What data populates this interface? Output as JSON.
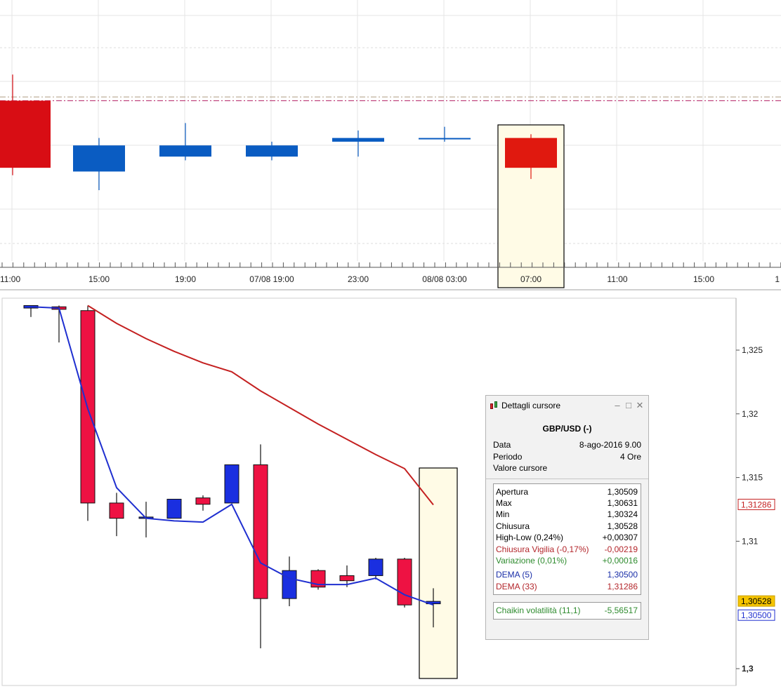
{
  "chart_data": [
    {
      "type": "candlestick",
      "x_labels": [
        "11:00",
        "15:00",
        "19:00",
        "07/08 19:00",
        "23:00",
        "08/08 03:00",
        "07:00",
        "11:00",
        "15:00",
        "1"
      ],
      "candles": [
        {
          "open": 1.3068,
          "high": 1.3075,
          "low": 1.3048,
          "close": 1.305
        },
        {
          "open": 1.3049,
          "high": 1.3058,
          "low": 1.3044,
          "close": 1.3056
        },
        {
          "open": 1.3053,
          "high": 1.3062,
          "low": 1.3052,
          "close": 1.3056
        },
        {
          "open": 1.3053,
          "high": 1.3057,
          "low": 1.3052,
          "close": 1.3056
        },
        {
          "open": 1.3057,
          "high": 1.306,
          "low": 1.3053,
          "close": 1.3058
        },
        {
          "open": 1.3058,
          "high": 1.3061,
          "low": 1.3057,
          "close": 1.3058
        },
        {
          "open": 1.3058,
          "high": 1.3059,
          "low": 1.3047,
          "close": 1.305
        }
      ],
      "highlighted_candle": 6,
      "ylim": [
        1.3025,
        1.3095
      ],
      "reference_lines": [
        {
          "value": 1.3069,
          "color": "#b8a890"
        },
        {
          "value": 1.3068,
          "color": "#c0457e"
        }
      ]
    },
    {
      "type": "candlestick",
      "y_ticks": [
        "1,325",
        "1,32",
        "1,315",
        "1,31",
        "1,3"
      ],
      "ylim": [
        1.2995,
        1.3285
      ],
      "candles": [
        {
          "open": 1.3283,
          "high": 1.3285,
          "low": 1.3276,
          "close": 1.3285
        },
        {
          "open": 1.3284,
          "high": 1.3285,
          "low": 1.3256,
          "close": 1.3282
        },
        {
          "open": 1.3281,
          "high": 1.3285,
          "low": 1.3116,
          "close": 1.313
        },
        {
          "open": 1.313,
          "high": 1.3138,
          "low": 1.3104,
          "close": 1.3118
        },
        {
          "open": 1.3118,
          "high": 1.3131,
          "low": 1.3103,
          "close": 1.3119
        },
        {
          "open": 1.3118,
          "high": 1.3133,
          "low": 1.3118,
          "close": 1.3133
        },
        {
          "open": 1.3134,
          "high": 1.3136,
          "low": 1.3124,
          "close": 1.3129
        },
        {
          "open": 1.313,
          "high": 1.316,
          "low": 1.313,
          "close": 1.316
        },
        {
          "open": 1.316,
          "high": 1.3176,
          "low": 1.3016,
          "close": 1.3055
        },
        {
          "open": 1.3055,
          "high": 1.3088,
          "low": 1.3049,
          "close": 1.3077
        },
        {
          "open": 1.3077,
          "high": 1.3078,
          "low": 1.3062,
          "close": 1.3064
        },
        {
          "open": 1.3073,
          "high": 1.3081,
          "low": 1.3064,
          "close": 1.3069
        },
        {
          "open": 1.3073,
          "high": 1.3087,
          "low": 1.307,
          "close": 1.3086
        },
        {
          "open": 1.3086,
          "high": 1.3087,
          "low": 1.3048,
          "close": 1.305
        },
        {
          "open": 1.30509,
          "high": 1.30631,
          "low": 1.30324,
          "close": 1.30528
        }
      ],
      "highlighted_candle": 14,
      "series": [
        {
          "name": "DEMA (5)",
          "color": "#1f2fd0",
          "values": [
            1.3284,
            1.3283,
            1.3204,
            1.3142,
            1.3118,
            1.3116,
            1.3115,
            1.3129,
            1.3083,
            1.3071,
            1.3066,
            1.3066,
            1.3071,
            1.3058,
            1.305
          ]
        },
        {
          "name": "DEMA (33)",
          "color": "#c42020",
          "values": [
            null,
            null,
            1.3285,
            1.3271,
            1.3259,
            1.3249,
            1.324,
            1.3233,
            1.3218,
            1.3205,
            1.3192,
            1.318,
            1.3168,
            1.3157,
            1.31286
          ]
        }
      ],
      "price_labels": [
        {
          "text": "1,31286",
          "value": 1.31286,
          "color": "#c42020",
          "bg": "#ffffff"
        },
        {
          "text": "1,30528",
          "value": 1.30528,
          "color": "#000000",
          "bg": "#f5c400"
        },
        {
          "text": "1,30500",
          "value": 1.305,
          "color": "#1f2fd0",
          "bg": "#ffffff"
        }
      ]
    }
  ],
  "cursor_panel": {
    "title": "Dettagli cursore",
    "instrument": "GBP/USD (-)",
    "info": [
      {
        "label": "Data",
        "value": "8-ago-2016 9.00"
      },
      {
        "label": "Periodo",
        "value": "4 Ore"
      },
      {
        "label": "Valore cursore",
        "value": ""
      }
    ],
    "values": [
      {
        "label": "Apertura",
        "value": "1,30509",
        "color": "default"
      },
      {
        "label": "Max",
        "value": "1,30631",
        "color": "default"
      },
      {
        "label": "Min",
        "value": "1,30324",
        "color": "default"
      },
      {
        "label": "Chiusura",
        "value": "1,30528",
        "color": "default"
      },
      {
        "label": "High-Low (0,24%)",
        "value": "+0,00307",
        "color": "default"
      },
      {
        "label": "Chiusura Vigilia (-0,17%)",
        "value": "-0,00219",
        "color": "red"
      },
      {
        "label": "Variazione (0,01%)",
        "value": "+0,00016",
        "color": "green"
      }
    ],
    "indicators": [
      {
        "label": "DEMA (5)",
        "value": "1,30500",
        "color": "blue"
      },
      {
        "label": "DEMA (33)",
        "value": "1,31286",
        "color": "red"
      }
    ],
    "volatility": {
      "label": "Chaikin volatilità (11,1)",
      "value": "-5,56517"
    }
  }
}
